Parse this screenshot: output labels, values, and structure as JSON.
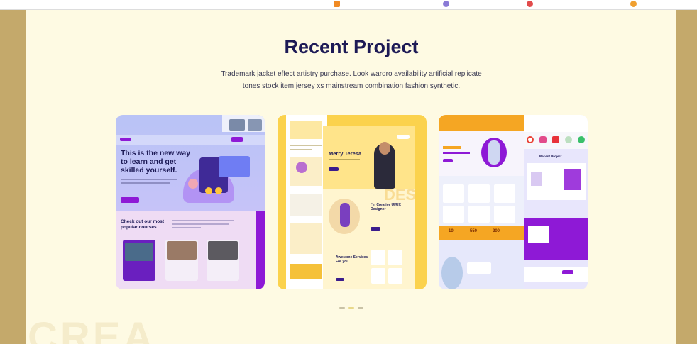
{
  "section": {
    "title": "Recent Project",
    "subtitle_line1": "Trademark jacket effect artistry purchase. Look wardro availability artificial replicate",
    "subtitle_line2": "tones stock item jersey xs mainstream combination fashion synthetic."
  },
  "projects": [
    {
      "hero_line1": "This is the new way",
      "hero_line2": "to learn and get",
      "hero_line3": "skilled yourself.",
      "courses_heading1": "Check out our most",
      "courses_heading2": "popular courses"
    },
    {
      "name_line": "Merry Teresa",
      "role_line1": "I'm Creative UI/UX",
      "role_line2": "Designer",
      "services_line1": "Awesome Services",
      "services_line2": "For you",
      "bg_text": "DES"
    },
    {
      "heading": "Recent Project",
      "stat1": "10",
      "stat2": "550",
      "stat3": "200"
    }
  ],
  "watermark": "CREA",
  "colors": {
    "accent": "#1d1a56",
    "purple": "#8e19d6",
    "yellow": "#fbd24d",
    "orange": "#f5a623",
    "frame": "#c4a96b",
    "background": "#fefae3"
  }
}
